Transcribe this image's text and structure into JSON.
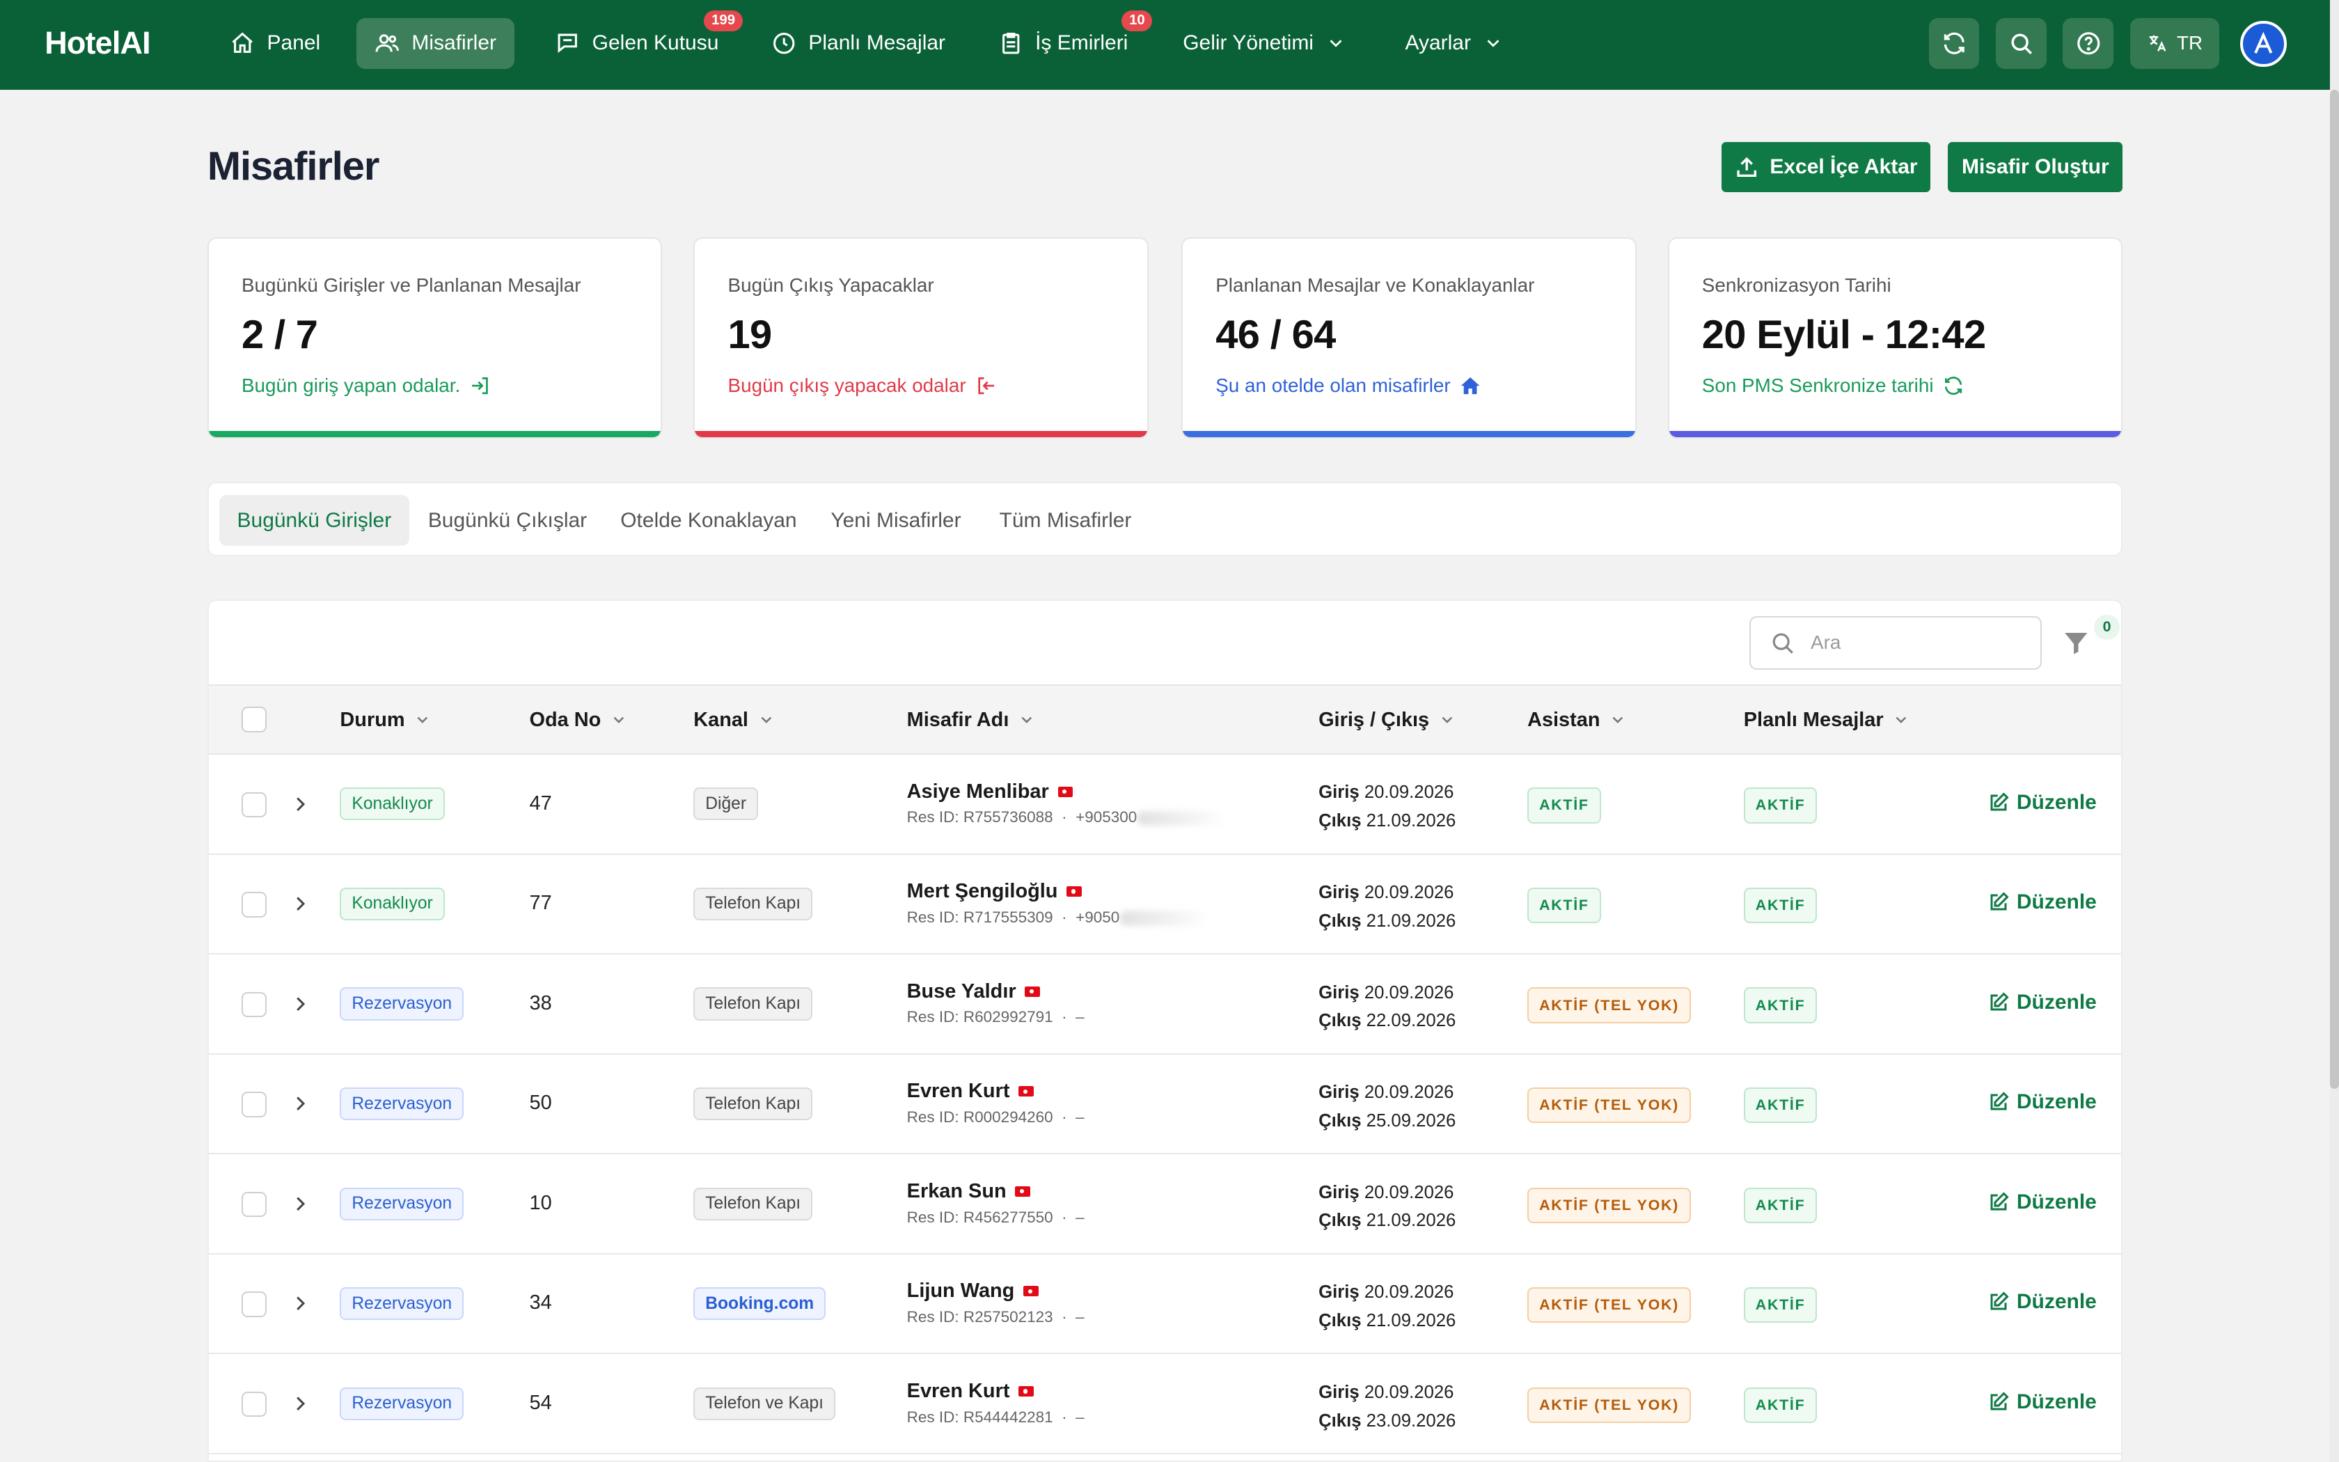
{
  "nav": {
    "brand": "HotelAI",
    "items": [
      {
        "label": "Panel"
      },
      {
        "label": "Misafirler"
      },
      {
        "label": "Gelen Kutusu",
        "badge": "199"
      },
      {
        "label": "Planlı Mesajlar"
      },
      {
        "label": "İş Emirleri",
        "badge": "10"
      },
      {
        "label": "Gelir Yönetimi"
      },
      {
        "label": "Ayarlar"
      }
    ],
    "language": "TR"
  },
  "page": {
    "title": "Misafirler",
    "import_button": "Excel İçe Aktar",
    "create_button": "Misafir Oluştur"
  },
  "stats": [
    {
      "label": "Bugünkü Girişler ve Planlanan Mesajlar",
      "value": "2 / 7",
      "link": "Bugün giriş yapan odalar.",
      "color": "#1aa863"
    },
    {
      "label": "Bugün Çıkış Yapacaklar",
      "value": "19",
      "link": "Bugün çıkış yapacak odalar",
      "color": "#e03a48"
    },
    {
      "label": "Planlanan Mesajlar ve Konaklayanlar",
      "value": "46 / 64",
      "link": "Şu an otelde olan misafirler",
      "color": "#3b6fe0"
    },
    {
      "label": "Senkronizasyon Tarihi",
      "value": "20 Eylül - 12:42",
      "link": "Son PMS Senkronize tarihi",
      "color": "#5b5ce0"
    }
  ],
  "tabs": [
    "Bugünkü Girişler",
    "Bugünkü Çıkışlar",
    "Otelde Konaklayan",
    "Yeni Misafirler",
    "Tüm Misafirler"
  ],
  "table": {
    "search_placeholder": "Ara",
    "filter_count": "0",
    "columns": [
      "Durum",
      "Oda No",
      "Kanal",
      "Misafir Adı",
      "Giriş / Çıkış",
      "Asistan",
      "Planlı Mesajlar"
    ],
    "checkin_label": "Giriş",
    "checkout_label": "Çıkış",
    "edit_label": "Düzenle",
    "rows": [
      {
        "status": "Konaklıyor",
        "room": "47",
        "channel": "Diğer",
        "name": "Asiye Menlibar",
        "res": "Res ID: R755736088",
        "phone": "+905300",
        "checkin": "20.09.2026",
        "checkout": "21.09.2026",
        "assistant": "AKTİF",
        "planned": "AKTİF"
      },
      {
        "status": "Konaklıyor",
        "room": "77",
        "channel": "Telefon Kapı",
        "name": "Mert Şengiloğlu",
        "res": "Res ID: R717555309",
        "phone": "+9050",
        "checkin": "20.09.2026",
        "checkout": "21.09.2026",
        "assistant": "AKTİF",
        "planned": "AKTİF"
      },
      {
        "status": "Rezervasyon",
        "room": "38",
        "channel": "Telefon Kapı",
        "name": "Buse Yaldır",
        "res": "Res ID: R602992791",
        "phone": "–",
        "checkin": "20.09.2026",
        "checkout": "22.09.2026",
        "assistant": "AKTİF (TEL YOK)",
        "planned": "AKTİF"
      },
      {
        "status": "Rezervasyon",
        "room": "50",
        "channel": "Telefon Kapı",
        "name": "Evren Kurt",
        "res": "Res ID: R000294260",
        "phone": "–",
        "checkin": "20.09.2026",
        "checkout": "25.09.2026",
        "assistant": "AKTİF (TEL YOK)",
        "planned": "AKTİF"
      },
      {
        "status": "Rezervasyon",
        "room": "10",
        "channel": "Telefon Kapı",
        "name": "Erkan Sun",
        "res": "Res ID: R456277550",
        "phone": "–",
        "checkin": "20.09.2026",
        "checkout": "21.09.2026",
        "assistant": "AKTİF (TEL YOK)",
        "planned": "AKTİF"
      },
      {
        "status": "Rezervasyon",
        "room": "34",
        "channel": "Booking.com",
        "name": "Lijun Wang",
        "res": "Res ID: R257502123",
        "phone": "–",
        "checkin": "20.09.2026",
        "checkout": "21.09.2026",
        "assistant": "AKTİF (TEL YOK)",
        "planned": "AKTİF"
      },
      {
        "status": "Rezervasyon",
        "room": "54",
        "channel": "Telefon ve Kapı",
        "name": "Evren Kurt",
        "res": "Res ID: R544442281",
        "phone": "–",
        "checkin": "20.09.2026",
        "checkout": "23.09.2026",
        "assistant": "AKTİF (TEL YOK)",
        "planned": "AKTİF"
      }
    ]
  }
}
